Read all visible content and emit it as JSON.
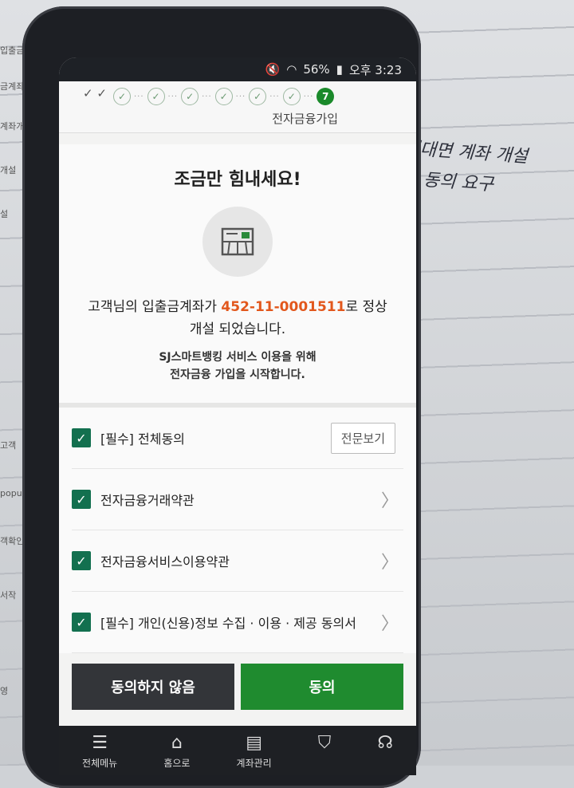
{
  "status_bar": {
    "battery": "56%",
    "time": "오후 3:23"
  },
  "app_bar": {
    "back_checks": "✓ ✓",
    "steps": [
      "✓",
      "✓",
      "✓",
      "✓",
      "✓",
      "✓"
    ],
    "current_step": "7",
    "title": "전자금융가입"
  },
  "hero": {
    "title": "조금만 힘내세요!",
    "message_prefix": "고객님의 입출금계좌가 ",
    "account_number": "452-11-0001511",
    "message_suffix": "로 정상",
    "message_line2": "개설 되었습니다.",
    "sub_line1": "SJ스마트뱅킹 서비스 이용을 위해",
    "sub_line2": "전자금융 가입을 시작합니다."
  },
  "agreements": {
    "all_label": "[필수] 전체동의",
    "view_full_label": "전문보기",
    "items": [
      {
        "label": "전자금융거래약관"
      },
      {
        "label": "전자금융서비스이용약관"
      },
      {
        "label": "[필수] 개인(신용)정보 수집 · 이용 · 제공 동의서"
      }
    ]
  },
  "buttons": {
    "decline": "동의하지 않음",
    "agree": "동의"
  },
  "bottom_nav": [
    {
      "label": "전체메뉴",
      "icon": "menu-icon"
    },
    {
      "label": "홈으로",
      "icon": "home-icon"
    },
    {
      "label": "계좌관리",
      "icon": "document-icon"
    },
    {
      "label": "",
      "icon": "shield-icon"
    },
    {
      "label": "",
      "icon": "headset-icon"
    }
  ],
  "background": {
    "paper_labels": [
      "입출금계좌개설",
      "금계좌개",
      "계좌개설",
      "개설",
      "설",
      "고객",
      "popu",
      "객확인",
      "서작",
      "영"
    ],
    "handwriting_line1": "비대면 계좌 개설",
    "handwriting_line2": "는 동의 요구"
  },
  "colors": {
    "accent_green": "#1f8b2f",
    "checkbox_green": "#13704f",
    "account_orange": "#e2571c"
  }
}
